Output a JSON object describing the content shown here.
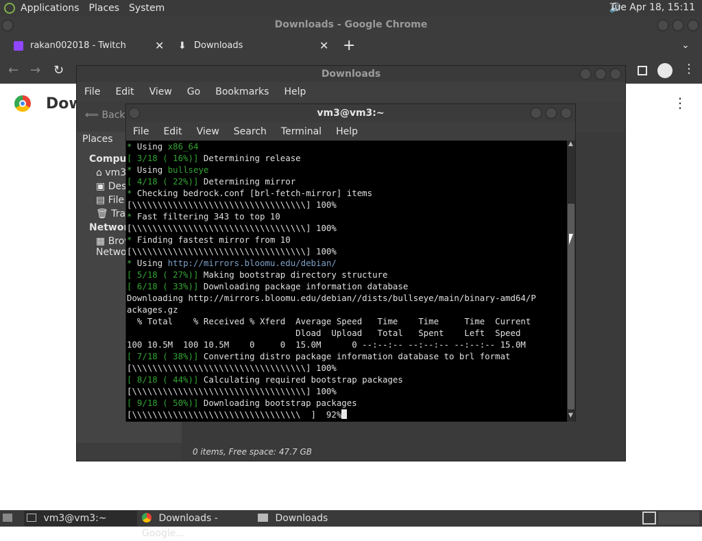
{
  "top_panel": {
    "menus": [
      "Applications",
      "Places",
      "System"
    ],
    "clock": "Tue Apr 18, 15:11"
  },
  "chrome": {
    "title": "Downloads - Google Chrome",
    "tabs": [
      {
        "label": "rakan002018 - Twitch"
      },
      {
        "label": "Downloads"
      }
    ],
    "page_heading": "Dow"
  },
  "file_manager": {
    "title": "Downloads",
    "menu": [
      "File",
      "Edit",
      "View",
      "Go",
      "Bookmarks",
      "Help"
    ],
    "back_label": "Back",
    "places_label": "Places",
    "sidebar": {
      "computer_label": "Computer",
      "computer_items": [
        "vm3",
        "Desktop",
        "File System",
        "Trash"
      ],
      "network_label": "Network",
      "network_items": [
        "Browse Network"
      ]
    },
    "status": "0 items, Free space: 47.7 GB"
  },
  "terminal": {
    "title": "vm3@vm3:~",
    "menu": [
      "File",
      "Edit",
      "View",
      "Search",
      "Terminal",
      "Help"
    ],
    "lines": [
      {
        "segments": [
          {
            "t": "* ",
            "c": "t-star"
          },
          {
            "t": "Using "
          },
          {
            "t": "x86_64",
            "c": "t-grn"
          }
        ]
      },
      {
        "segments": [
          {
            "t": "[ 3/18 ( 16%)]",
            "c": "t-grn"
          },
          {
            "t": " Determining release"
          }
        ]
      },
      {
        "segments": [
          {
            "t": "* ",
            "c": "t-star"
          },
          {
            "t": "Using "
          },
          {
            "t": "bullseye",
            "c": "t-grn"
          }
        ]
      },
      {
        "segments": [
          {
            "t": "[ 4/18 ( 22%)]",
            "c": "t-grn"
          },
          {
            "t": " Determining mirror"
          }
        ]
      },
      {
        "segments": [
          {
            "t": "* ",
            "c": "t-star"
          },
          {
            "t": "Checking bedrock.conf [brl-fetch-mirror] items"
          }
        ]
      },
      {
        "segments": [
          {
            "t": "[\\\\\\\\\\\\\\\\\\\\\\\\\\\\\\\\\\\\\\\\\\\\\\\\\\\\\\\\\\\\\\\\\\\\] 100%"
          }
        ]
      },
      {
        "segments": [
          {
            "t": "* ",
            "c": "t-star"
          },
          {
            "t": "Fast filtering 343 to top 10"
          }
        ]
      },
      {
        "segments": [
          {
            "t": "[\\\\\\\\\\\\\\\\\\\\\\\\\\\\\\\\\\\\\\\\\\\\\\\\\\\\\\\\\\\\\\\\\\\\] 100%"
          }
        ]
      },
      {
        "segments": [
          {
            "t": "* ",
            "c": "t-star"
          },
          {
            "t": "Finding fastest mirror from 10"
          }
        ]
      },
      {
        "segments": [
          {
            "t": "[\\\\\\\\\\\\\\\\\\\\\\\\\\\\\\\\\\\\\\\\\\\\\\\\\\\\\\\\\\\\\\\\\\\\] 100%"
          }
        ]
      },
      {
        "segments": [
          {
            "t": "* ",
            "c": "t-star"
          },
          {
            "t": "Using "
          },
          {
            "t": "http://mirrors.bloomu.edu/debian/",
            "c": "t-val"
          }
        ]
      },
      {
        "segments": [
          {
            "t": "[ 5/18 ( 27%)]",
            "c": "t-grn"
          },
          {
            "t": " Making bootstrap directory structure"
          }
        ]
      },
      {
        "segments": [
          {
            "t": "[ 6/18 ( 33%)]",
            "c": "t-grn"
          },
          {
            "t": " Downloading package information database"
          }
        ]
      },
      {
        "segments": [
          {
            "t": "Downloading http://mirrors.bloomu.edu/debian//dists/bullseye/main/binary-amd64/P"
          }
        ]
      },
      {
        "segments": [
          {
            "t": "ackages.gz"
          }
        ]
      },
      {
        "segments": [
          {
            "t": "  % Total    % Received % Xferd  Average Speed   Time    Time     Time  Current"
          }
        ]
      },
      {
        "segments": [
          {
            "t": "                                 Dload  Upload   Total   Spent    Left  Speed"
          }
        ]
      },
      {
        "segments": [
          {
            "t": "100 10.5M  100 10.5M    0     0  15.0M      0 --:--:-- --:--:-- --:--:-- 15.0M"
          }
        ]
      },
      {
        "segments": [
          {
            "t": "[ 7/18 ( 38%)]",
            "c": "t-grn"
          },
          {
            "t": " Converting distro package information database to brl format"
          }
        ]
      },
      {
        "segments": [
          {
            "t": "[\\\\\\\\\\\\\\\\\\\\\\\\\\\\\\\\\\\\\\\\\\\\\\\\\\\\\\\\\\\\\\\\\\\\] 100%"
          }
        ]
      },
      {
        "segments": [
          {
            "t": "[ 8/18 ( 44%)]",
            "c": "t-grn"
          },
          {
            "t": " Calculating required bootstrap packages"
          }
        ]
      },
      {
        "segments": [
          {
            "t": "[\\\\\\\\\\\\\\\\\\\\\\\\\\\\\\\\\\\\\\\\\\\\\\\\\\\\\\\\\\\\\\\\\\\\] 100%"
          }
        ]
      },
      {
        "segments": [
          {
            "t": "[ 9/18 ( 50%)]",
            "c": "t-grn"
          },
          {
            "t": " Downloading bootstrap packages"
          }
        ]
      },
      {
        "segments": [
          {
            "t": "[\\\\\\\\\\\\\\\\\\\\\\\\\\\\\\\\\\\\\\\\\\\\\\\\\\\\\\\\\\\\\\\\\\  ]  92%"
          }
        ],
        "cursor": true
      }
    ]
  },
  "taskbar": {
    "items": [
      {
        "label": "vm3@vm3:~"
      },
      {
        "label": "Downloads - Google..."
      },
      {
        "label": "Downloads"
      }
    ]
  }
}
